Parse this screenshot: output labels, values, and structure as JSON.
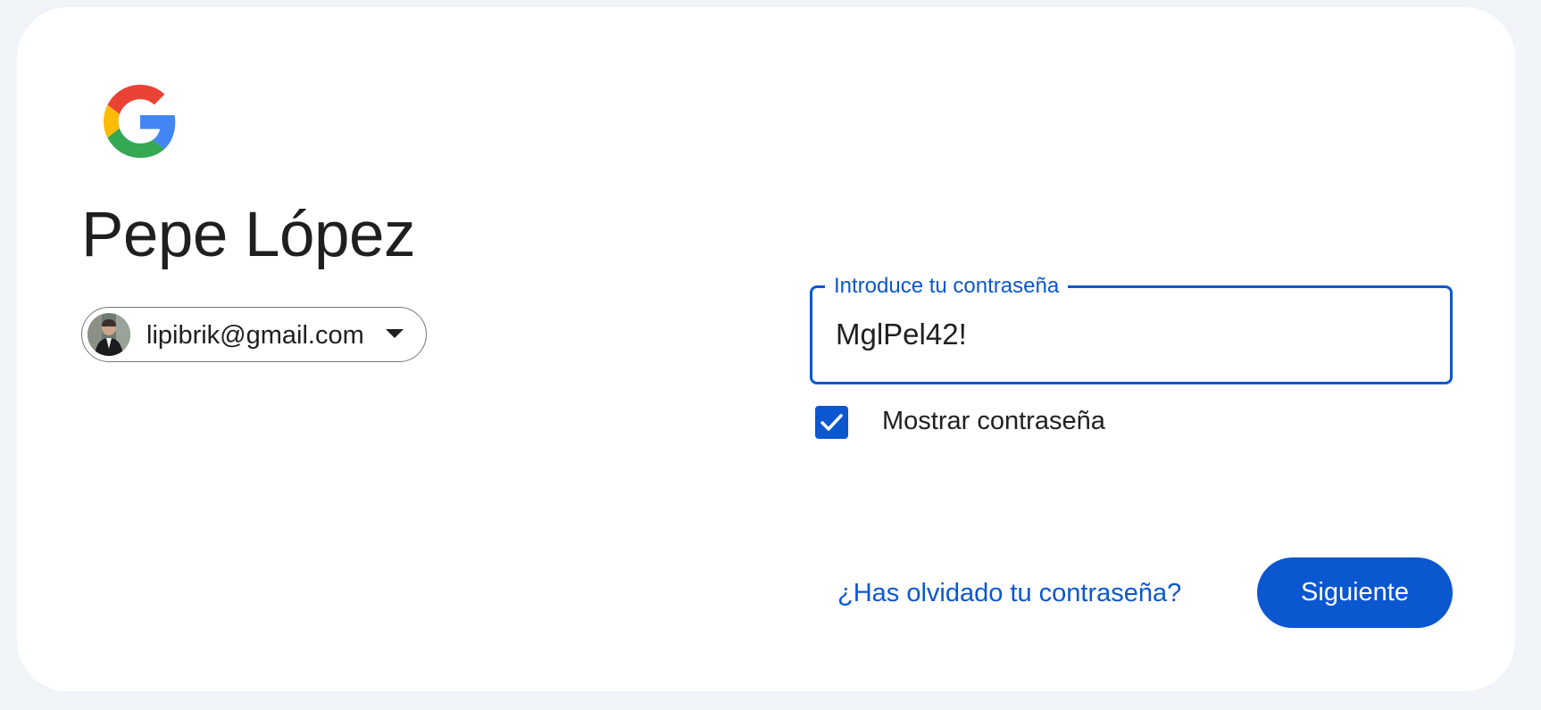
{
  "colors": {
    "background": "#f0f4f9",
    "card": "#ffffff",
    "accent": "#0b57d0",
    "text": "#1f1f1f",
    "outline": "#747775"
  },
  "logo": {
    "icon": "google-g-logo"
  },
  "account": {
    "name": "Pepe López",
    "email": "lipibrik@gmail.com",
    "avatar_icon": "user-avatar",
    "dropdown_icon": "caret-down-icon"
  },
  "password": {
    "label": "Introduce tu contraseña",
    "value": "MglPel42!"
  },
  "show_password": {
    "label": "Mostrar contraseña",
    "checked": true
  },
  "actions": {
    "forgot_label": "¿Has olvidado tu contraseña?",
    "next_label": "Siguiente"
  }
}
